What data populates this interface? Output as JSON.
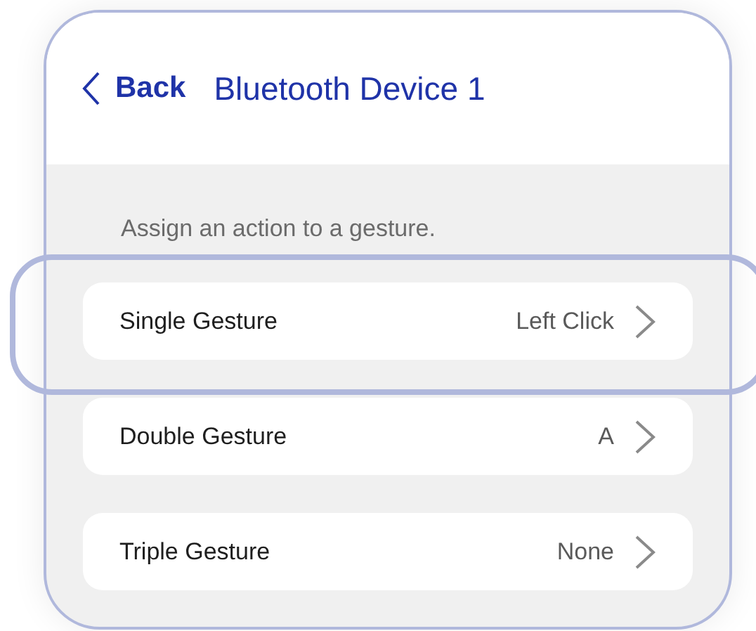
{
  "header": {
    "back": {
      "label": "Back"
    },
    "title": "Bluetooth Device 1"
  },
  "hint": "Assign an action to a gesture.",
  "rows": [
    {
      "label": "Single Gesture",
      "value": "Left Click",
      "selected": true
    },
    {
      "label": "Double Gesture",
      "value": "A",
      "selected": false
    },
    {
      "label": "Triple Gesture",
      "value": "None",
      "selected": false
    }
  ]
}
